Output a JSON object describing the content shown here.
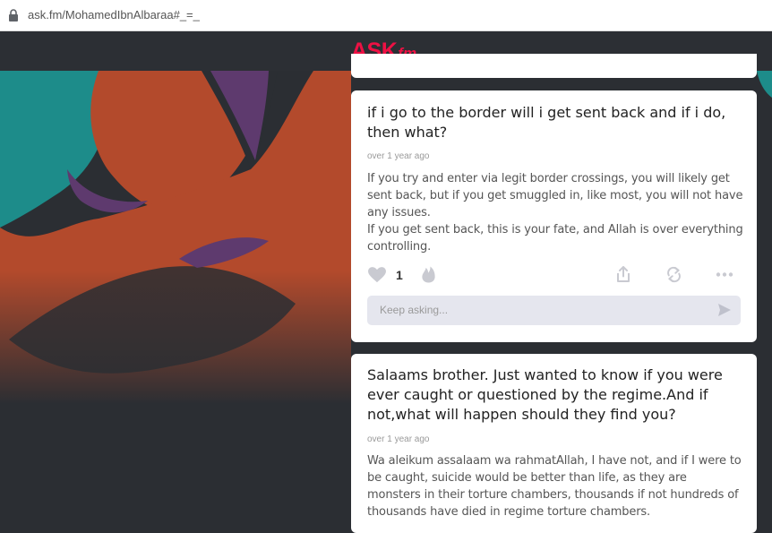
{
  "browser": {
    "url": "ask.fm/MohamedIbnAlbaraa#_=_"
  },
  "app": {
    "logo_main": "ASK",
    "logo_suffix": "fm",
    "brand_color": "#ee1144"
  },
  "posts": [
    {
      "question": "if i go to the border will i get sent back and if i do, then what?",
      "time": "over 1 year ago",
      "answer": [
        "If you try and enter via legit border crossings, you will likely get sent back, but if you get smuggled in, like most, you will not have any issues.",
        "If you get sent back, this is your fate, and Allah is over everything controlling."
      ],
      "likes": "1",
      "ask_placeholder": "Keep asking..."
    },
    {
      "question": "Salaams brother. Just wanted to know if you were ever caught or questioned by the regime.And if not,what will happen should they find you?",
      "time": "over 1 year ago",
      "answer": [
        "Wa aleikum assalaam wa rahmatAllah, I have not, and if I were to be caught, suicide would be better than life, as they are monsters in their torture chambers, thousands if not hundreds of thousands have died in regime torture chambers."
      ]
    }
  ]
}
